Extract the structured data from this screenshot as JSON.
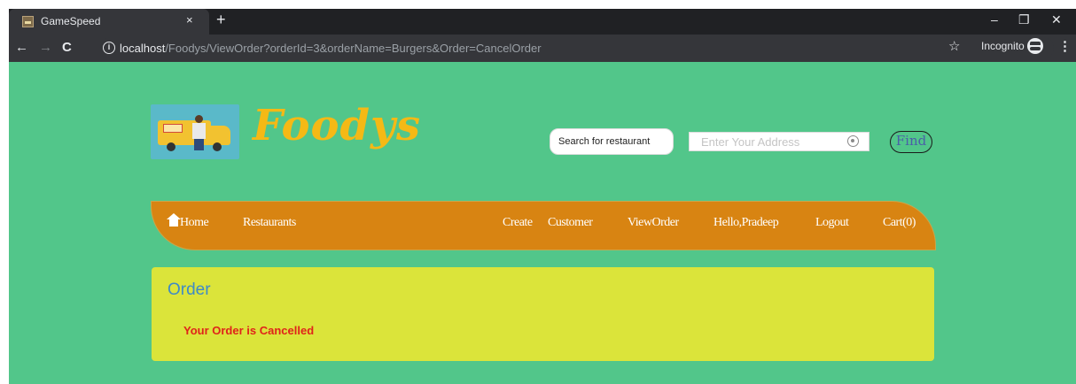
{
  "browser": {
    "tab_title": "GameSpeed",
    "tab_close": "×",
    "new_tab": "+",
    "window_controls": {
      "minimize": "–",
      "restore": "❐",
      "close": "✕"
    },
    "nav": {
      "back": "←",
      "forward": "→",
      "reload": "C"
    },
    "url": {
      "host": "localhost",
      "path": "/Foodys/ViewOrder?orderId=3&orderName=Burgers&Order=CancelOrder"
    },
    "incognito_label": "Incognito",
    "menu": "⋮",
    "star": "☆"
  },
  "site": {
    "brand": "Foodys",
    "search": {
      "placeholder": "Search for restaurant",
      "value": ""
    },
    "address": {
      "placeholder": "Enter Your Address",
      "value": ""
    },
    "find_label": "Find",
    "nav": {
      "home": "Home",
      "restaurants": "Restaurants",
      "create": "Create",
      "customer": "Customer",
      "view_order": "ViewOrder",
      "greeting": "Hello,Pradeep",
      "logout": "Logout",
      "cart": "Cart(0)"
    },
    "order": {
      "title": "Order",
      "message": "Your Order is Cancelled"
    }
  },
  "colors": {
    "page_bg": "#52c68a",
    "navbar_bg": "#d88412",
    "brand": "#f5b915",
    "order_panel": "#dbe43a",
    "order_title": "#3e8ac7",
    "order_message": "#e0231a"
  },
  "icons": [
    "info-icon",
    "star-icon",
    "incognito-icon",
    "menu-icon",
    "home-icon",
    "locate-icon"
  ]
}
